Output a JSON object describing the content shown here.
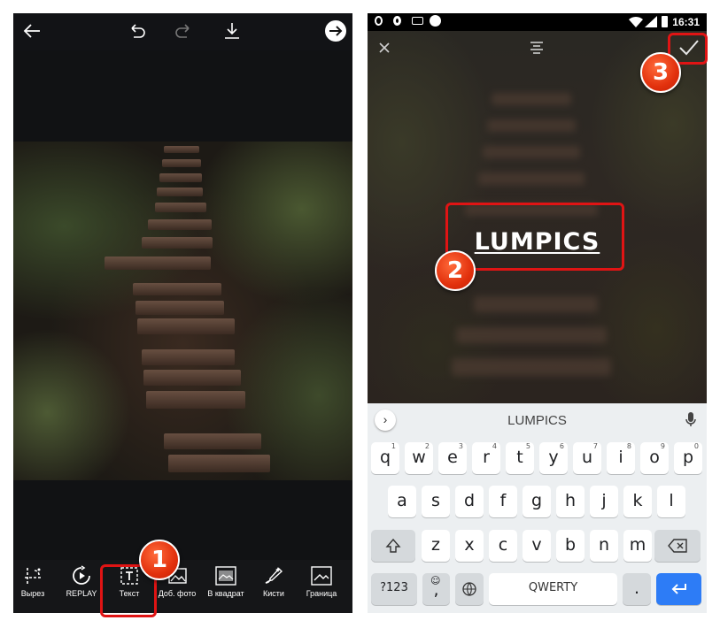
{
  "left_screen": {
    "top_icons": [
      "back-arrow-icon",
      "undo-icon",
      "redo-icon",
      "download-icon",
      "next-arrow-icon"
    ],
    "tools": [
      {
        "label": "Вырез",
        "icon": "cutout-icon"
      },
      {
        "label": "REPLAY",
        "icon": "replay-icon"
      },
      {
        "label": "Текст",
        "icon": "text-icon"
      },
      {
        "label": "Доб. фото",
        "icon": "add-photo-icon"
      },
      {
        "label": "В квадрат",
        "icon": "square-fit-icon"
      },
      {
        "label": "Кисти",
        "icon": "brushes-icon"
      },
      {
        "label": "Граница",
        "icon": "border-icon"
      }
    ]
  },
  "right_screen": {
    "status_bar": {
      "time": "16:31"
    },
    "overlay_text": "LUMPICS",
    "keyboard": {
      "suggestion": "LUMPICS",
      "row1": [
        {
          "k": "q",
          "n": "1"
        },
        {
          "k": "w",
          "n": "2"
        },
        {
          "k": "e",
          "n": "3"
        },
        {
          "k": "r",
          "n": "4"
        },
        {
          "k": "t",
          "n": "5"
        },
        {
          "k": "y",
          "n": "6"
        },
        {
          "k": "u",
          "n": "7"
        },
        {
          "k": "i",
          "n": "8"
        },
        {
          "k": "o",
          "n": "9"
        },
        {
          "k": "p",
          "n": "0"
        }
      ],
      "row2": [
        "a",
        "s",
        "d",
        "f",
        "g",
        "h",
        "j",
        "k",
        "l"
      ],
      "row3": [
        "z",
        "x",
        "c",
        "v",
        "b",
        "n",
        "m"
      ],
      "symbols_label": "?123",
      "comma": ",",
      "space_label": "QWERTY",
      "period": "."
    }
  },
  "annotations": {
    "badge_1": "1",
    "badge_2": "2",
    "badge_3": "3",
    "color": "#e01414"
  }
}
